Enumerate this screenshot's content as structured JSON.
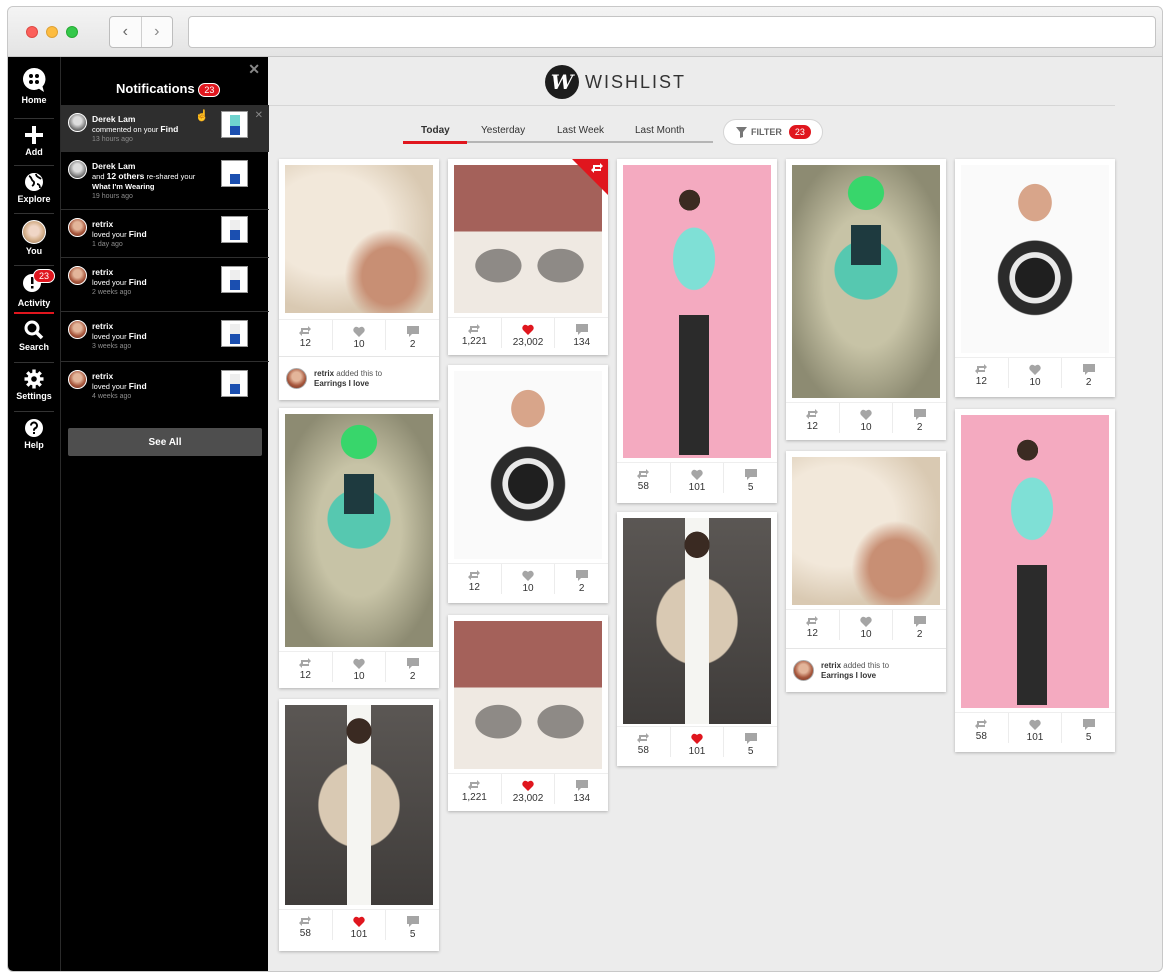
{
  "window": {
    "controls": [
      {
        "name": "close",
        "color": "#fc605b"
      },
      {
        "name": "minimize",
        "color": "#fdbc40"
      },
      {
        "name": "zoom",
        "color": "#34c84a"
      }
    ],
    "back": "‹",
    "forward": "›"
  },
  "sidebar": {
    "items": [
      {
        "label": "Home",
        "icon": "chat-bubble-icon"
      },
      {
        "label": "Add",
        "icon": "plus-icon"
      },
      {
        "label": "Explore",
        "icon": "globe-icon"
      },
      {
        "label": "You",
        "icon": "avatar-icon"
      },
      {
        "label": "Activity",
        "icon": "activity-icon",
        "badge": "23"
      },
      {
        "label": "Search",
        "icon": "search-icon"
      },
      {
        "label": "Settings",
        "icon": "gear-icon"
      },
      {
        "label": "Help",
        "icon": "help-icon"
      }
    ]
  },
  "notifications": {
    "title": "Notifications",
    "count": "23",
    "close": "✕",
    "see_all": "See All",
    "items": [
      {
        "name": "Derek Lam",
        "line1": "commented on your",
        "bold1": "Find",
        "time": "13 hours ago"
      },
      {
        "name": "Derek Lam",
        "line1": "and",
        "bold1": "12 others",
        "line2": "re-shared your",
        "bold2": "What I'm Wearing",
        "time": "19 hours ago"
      },
      {
        "name": "retrix",
        "line1": "loved your",
        "bold1": "Find",
        "time": "1 day ago"
      },
      {
        "name": "retrix",
        "line1": "loved your",
        "bold1": "Find",
        "time": "2 weeks ago"
      },
      {
        "name": "retrix",
        "line1": "loved your",
        "bold1": "Find",
        "time": "3 weeks ago"
      },
      {
        "name": "retrix",
        "line1": "loved your",
        "bold1": "Find",
        "time": "4 weeks ago"
      }
    ]
  },
  "header": {
    "logo_letter": "W",
    "logo_text": "WISHLIST"
  },
  "tabs": [
    {
      "label": "Today"
    },
    {
      "label": "Yesterday"
    },
    {
      "label": "Last Week"
    },
    {
      "label": "Last Month"
    }
  ],
  "filter": {
    "label": "FILTER",
    "count": "23"
  },
  "cards": [
    {
      "reshares": "12",
      "likes": "10",
      "comments": "2",
      "added_by": "retrix",
      "added_text": "added this to",
      "board": "Earrings I love"
    },
    {
      "reshares": "12",
      "likes": "10",
      "comments": "2"
    },
    {
      "reshares": "58",
      "likes": "101",
      "comments": "5"
    },
    {
      "reshares": "1,221",
      "likes": "23,002",
      "comments": "134"
    },
    {
      "reshares": "12",
      "likes": "10",
      "comments": "2"
    },
    {
      "reshares": "1,221",
      "likes": "23,002",
      "comments": "134"
    },
    {
      "reshares": "58",
      "likes": "101",
      "comments": "5"
    },
    {
      "reshares": "58",
      "likes": "101",
      "comments": "5"
    },
    {
      "reshares": "12",
      "likes": "10",
      "comments": "2"
    },
    {
      "reshares": "12",
      "likes": "10",
      "comments": "2",
      "added_by": "retrix",
      "added_text": "added this to",
      "board": "Earrings I love"
    },
    {
      "reshares": "12",
      "likes": "10",
      "comments": "2"
    },
    {
      "reshares": "58",
      "likes": "101",
      "comments": "5"
    }
  ],
  "colors": {
    "accent": "#e0161e",
    "heart_active": "#e0161e",
    "icon": "#a5a5a5"
  }
}
